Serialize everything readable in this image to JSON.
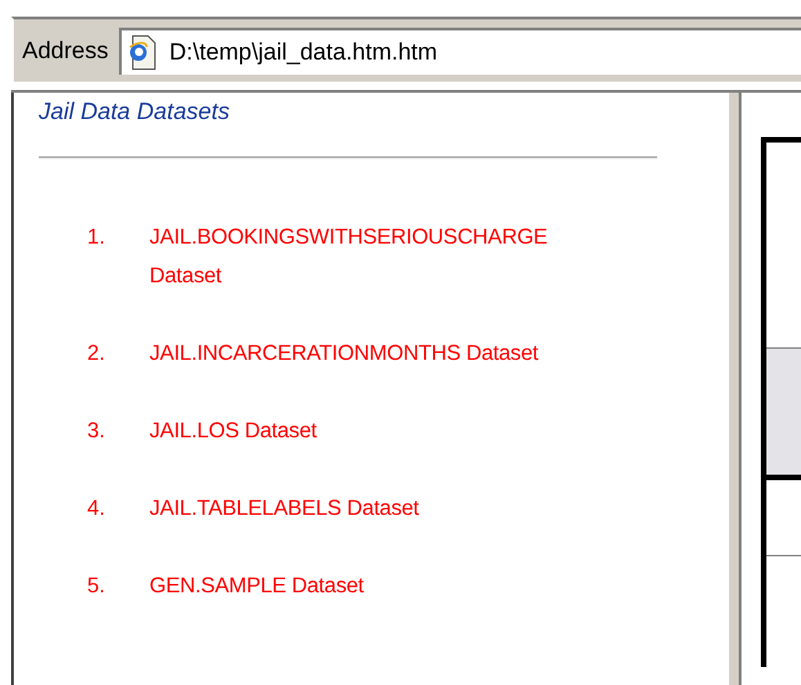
{
  "address_bar": {
    "label": "Address",
    "url": "D:\\temp\\jail_data.htm.htm"
  },
  "left_frame": {
    "title": "Jail Data Datasets",
    "datasets": [
      {
        "number": "1.",
        "name": "JAIL.BOOKINGSWITHSERIOUSCHARGE Dataset"
      },
      {
        "number": "2.",
        "name": "JAIL.INCARCERATIONMONTHS Dataset"
      },
      {
        "number": "3.",
        "name": "JAIL.LOS Dataset"
      },
      {
        "number": "4.",
        "name": "JAIL.TABLELABELS Dataset"
      },
      {
        "number": "5.",
        "name": "GEN.SAMPLE Dataset"
      }
    ]
  }
}
